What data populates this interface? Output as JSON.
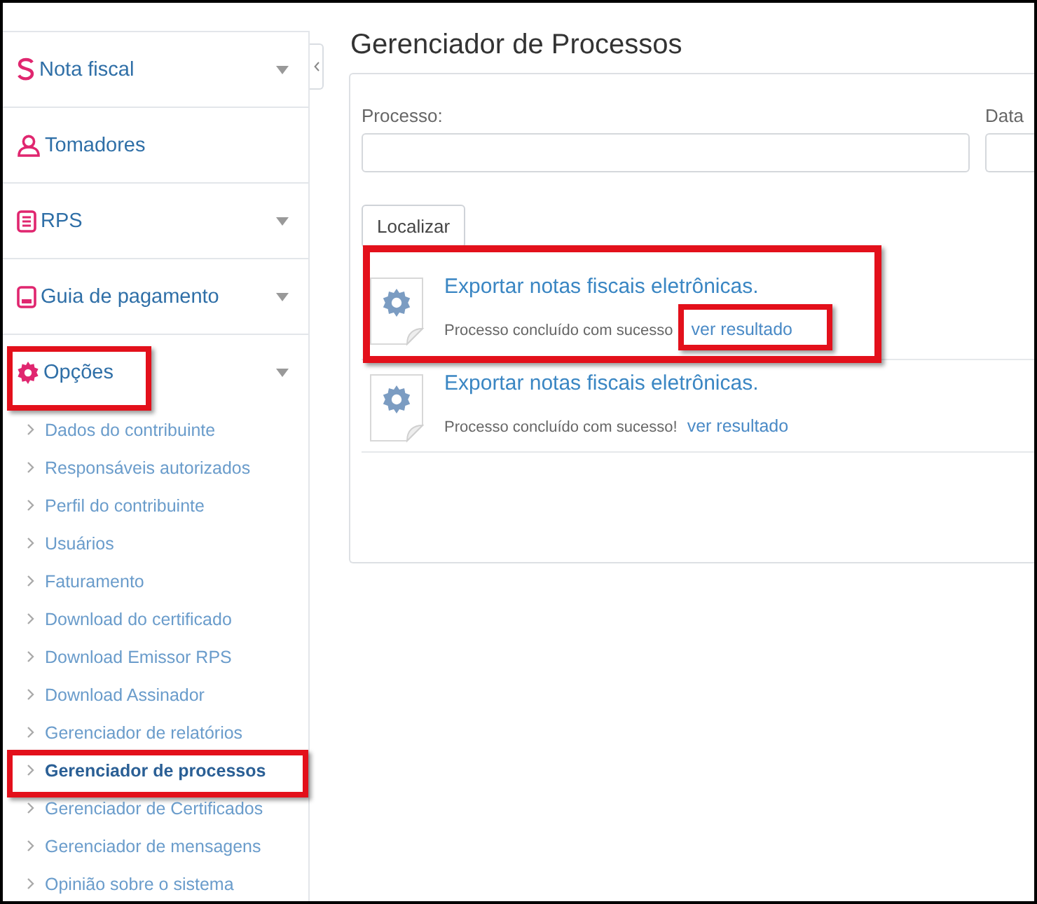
{
  "sidebar": {
    "items": [
      {
        "label": "Nota fiscal",
        "kind": "group",
        "highlighted": false
      },
      {
        "label": "Tomadores",
        "kind": "link",
        "highlighted": false
      },
      {
        "label": "RPS",
        "kind": "group",
        "highlighted": false
      },
      {
        "label": "Guia de pagamento",
        "kind": "group",
        "highlighted": false
      },
      {
        "label": "Opções",
        "kind": "group",
        "highlighted": true,
        "expanded": true,
        "children": [
          {
            "label": "Dados do contribuinte",
            "selected": false,
            "highlighted": false
          },
          {
            "label": "Responsáveis autorizados",
            "selected": false,
            "highlighted": false
          },
          {
            "label": "Perfil do contribuinte",
            "selected": false,
            "highlighted": false
          },
          {
            "label": "Usuários",
            "selected": false,
            "highlighted": false
          },
          {
            "label": "Faturamento",
            "selected": false,
            "highlighted": false
          },
          {
            "label": "Download do certificado",
            "selected": false,
            "highlighted": false
          },
          {
            "label": "Download Emissor RPS",
            "selected": false,
            "highlighted": false
          },
          {
            "label": "Download Assinador",
            "selected": false,
            "highlighted": false
          },
          {
            "label": "Gerenciador de relatórios",
            "selected": false,
            "highlighted": false
          },
          {
            "label": "Gerenciador de processos",
            "selected": true,
            "highlighted": true
          },
          {
            "label": "Gerenciador de Certificados",
            "selected": false,
            "highlighted": false
          },
          {
            "label": "Gerenciador de mensagens",
            "selected": false,
            "highlighted": false
          },
          {
            "label": "Opinião sobre o sistema",
            "selected": false,
            "highlighted": false
          }
        ]
      }
    ]
  },
  "page": {
    "title": "Gerenciador de Processos",
    "filters": [
      {
        "label": "Processo:"
      },
      {
        "label": "Data"
      }
    ],
    "search_button": "Localizar",
    "processes": [
      {
        "title": "Exportar notas fiscais eletrônicas.",
        "status": "Processo concluído com sucesso",
        "link": "ver resultado",
        "highlighted": true,
        "link_highlighted": true
      },
      {
        "title": "Exportar notas fiscais eletrônicas.",
        "status": "Processo concluído com sucesso!",
        "link": "ver resultado",
        "highlighted": false,
        "link_highlighted": false
      }
    ]
  }
}
